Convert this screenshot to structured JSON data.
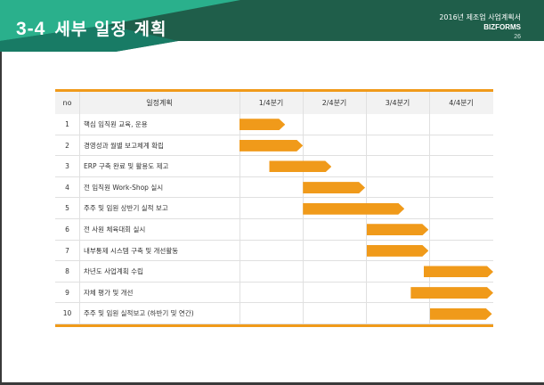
{
  "header": {
    "section_no": "3-4",
    "title": "세부 일정 계획",
    "doc_title": "2016년 제조업 사업계획서",
    "brand": "BIZFORMS",
    "page": "26"
  },
  "colors": {
    "header_green": "#1f5e4a",
    "header_teal": "#2ab08c",
    "bar_orange": "#f09a1a"
  },
  "table": {
    "headers": [
      "no",
      "일정계획",
      "1/4분기",
      "2/4분기",
      "3/4분기",
      "4/4분기"
    ],
    "rows": [
      {
        "no": "1",
        "task": "핵심 임직원 교육, 운용",
        "start_q": 0.0,
        "end_q": 0.72
      },
      {
        "no": "2",
        "task": "경영성과 월별 보고체계 확립",
        "start_q": 0.0,
        "end_q": 1.0
      },
      {
        "no": "3",
        "task": "ERP 구축 완료 및 활용도 제고",
        "start_q": 0.47,
        "end_q": 1.45
      },
      {
        "no": "4",
        "task": "전 임직원  Work-Shop 실시",
        "start_q": 1.0,
        "end_q": 1.98
      },
      {
        "no": "5",
        "task": "주주 및 임원 상반기 실적 보고",
        "start_q": 1.0,
        "end_q": 2.6
      },
      {
        "no": "6",
        "task": "전 사원 체육대회 실시",
        "start_q": 2.0,
        "end_q": 2.98
      },
      {
        "no": "7",
        "task": "내부통제 시스템 구축 및 개선활동",
        "start_q": 2.0,
        "end_q": 2.98
      },
      {
        "no": "8",
        "task": "차년도 사업계획 수립",
        "start_q": 2.9,
        "end_q": 4.0
      },
      {
        "no": "9",
        "task": "자체 평가 및 개선",
        "start_q": 2.7,
        "end_q": 4.0
      },
      {
        "no": "10",
        "task": "주주 및 임원 실적보고 (하반기 및 연간)",
        "start_q": 3.0,
        "end_q": 3.98
      }
    ]
  }
}
